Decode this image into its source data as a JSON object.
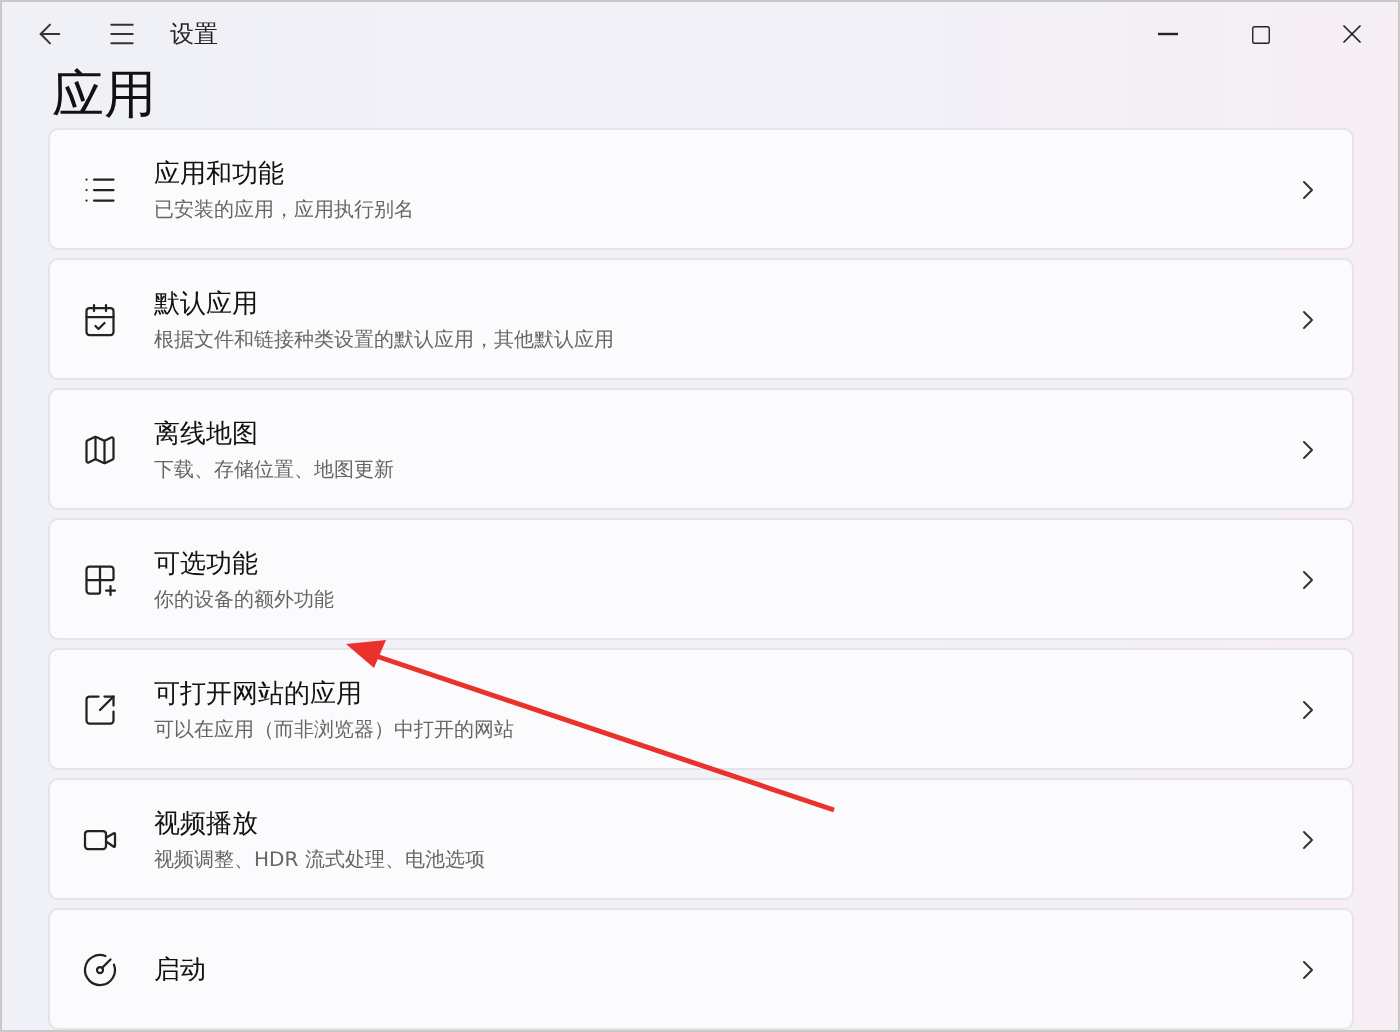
{
  "window": {
    "title": "设置"
  },
  "page": {
    "heading": "应用"
  },
  "items": [
    {
      "title": "应用和功能",
      "subtitle": "已安装的应用，应用执行别名"
    },
    {
      "title": "默认应用",
      "subtitle": "根据文件和链接种类设置的默认应用，其他默认应用"
    },
    {
      "title": "离线地图",
      "subtitle": "下载、存储位置、地图更新"
    },
    {
      "title": "可选功能",
      "subtitle": "你的设备的额外功能"
    },
    {
      "title": "可打开网站的应用",
      "subtitle": "可以在应用（而非浏览器）中打开的网站"
    },
    {
      "title": "视频播放",
      "subtitle": "视频调整、HDR 流式处理、电池选项"
    },
    {
      "title": "启动"
    }
  ]
}
